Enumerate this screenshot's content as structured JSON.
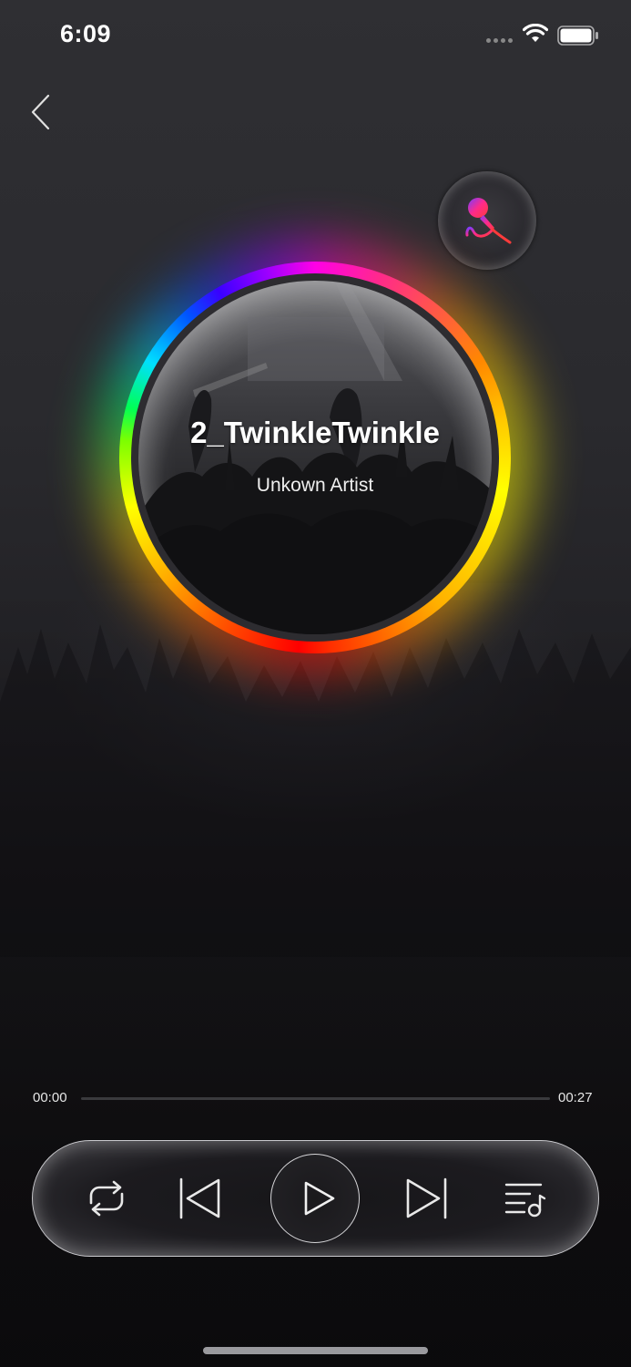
{
  "status_bar": {
    "time": "6:09",
    "icons": [
      "cellular-signal-icon",
      "wifi-icon",
      "battery-icon"
    ]
  },
  "navigation": {
    "back_icon": "chevron-left-icon"
  },
  "karaoke": {
    "icon": "microphone-icon",
    "colors": [
      "#7a3cff",
      "#ff2a8a",
      "#ff3b3b"
    ]
  },
  "track": {
    "title": "2_TwinkleTwinkle",
    "artist": "Unkown Artist"
  },
  "disc": {
    "ring_colors": [
      "#ff00e6",
      "#ff8800",
      "#ffff00",
      "#ff0000",
      "#00ff55",
      "#0055ff",
      "#9900ff"
    ]
  },
  "progress": {
    "current_time": "00:00",
    "total_time": "00:27",
    "fraction": 0.0
  },
  "controls": {
    "repeat": "repeat-icon",
    "previous": "skip-previous-icon",
    "play": "play-icon",
    "next": "skip-next-icon",
    "playlist": "playlist-music-icon"
  }
}
